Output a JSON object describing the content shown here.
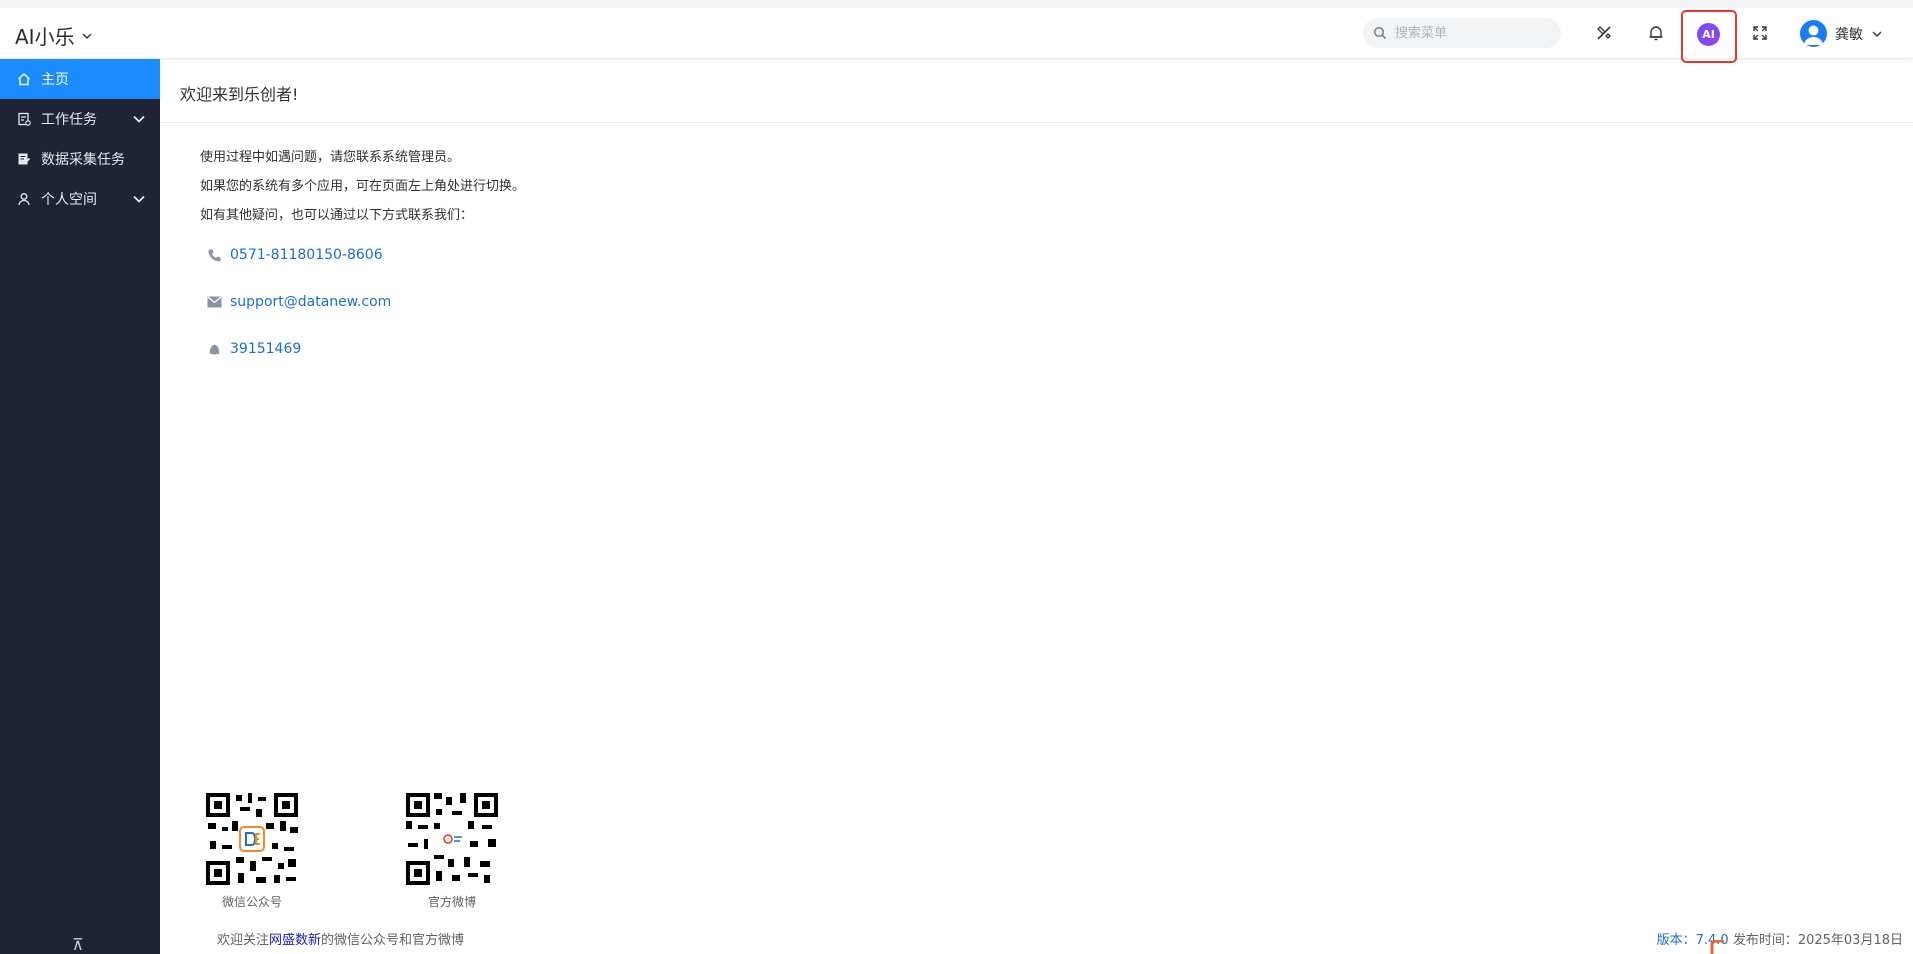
{
  "header": {
    "app_title": "AI小乐",
    "search_placeholder": "搜索菜单",
    "ai_label": "AI",
    "user_name": "龚敏"
  },
  "sidebar": {
    "items": [
      {
        "label": "主页",
        "icon": "home-icon",
        "active": true
      },
      {
        "label": "工作任务",
        "icon": "task-icon",
        "expandable": true
      },
      {
        "label": "数据采集任务",
        "icon": "edit-form-icon"
      },
      {
        "label": "个人空间",
        "icon": "user-icon",
        "expandable": true
      }
    ],
    "collapse_label": "⊼"
  },
  "main": {
    "welcome": "欢迎来到乐创者!",
    "intro": [
      "使用过程中如遇问题，请您联系系统管理员。",
      "如果您的系统有多个应用，可在页面左上角处进行切换。",
      "如有其他疑问，也可以通过以下方式联系我们："
    ],
    "contacts": [
      {
        "icon": "phone-icon",
        "text": "0571-81180150-8606"
      },
      {
        "icon": "mail-icon",
        "text": "support@datanew.com"
      },
      {
        "icon": "qq-icon",
        "text": "39151469"
      }
    ],
    "qr_codes": [
      {
        "caption": "微信公众号"
      },
      {
        "caption": "官方微博"
      }
    ],
    "footer": {
      "follow_prefix": "欢迎关注",
      "follow_link": "网盛数新",
      "follow_suffix": "的微信公众号和官方微博",
      "version": "版本：7.4.0",
      "release": "发布时间：2025年03月18日"
    }
  },
  "colors": {
    "sidebar_bg": "#1e2433",
    "active_bg": "#1a8cff",
    "link": "#1a6fd0",
    "highlight_border": "#e8372b"
  }
}
